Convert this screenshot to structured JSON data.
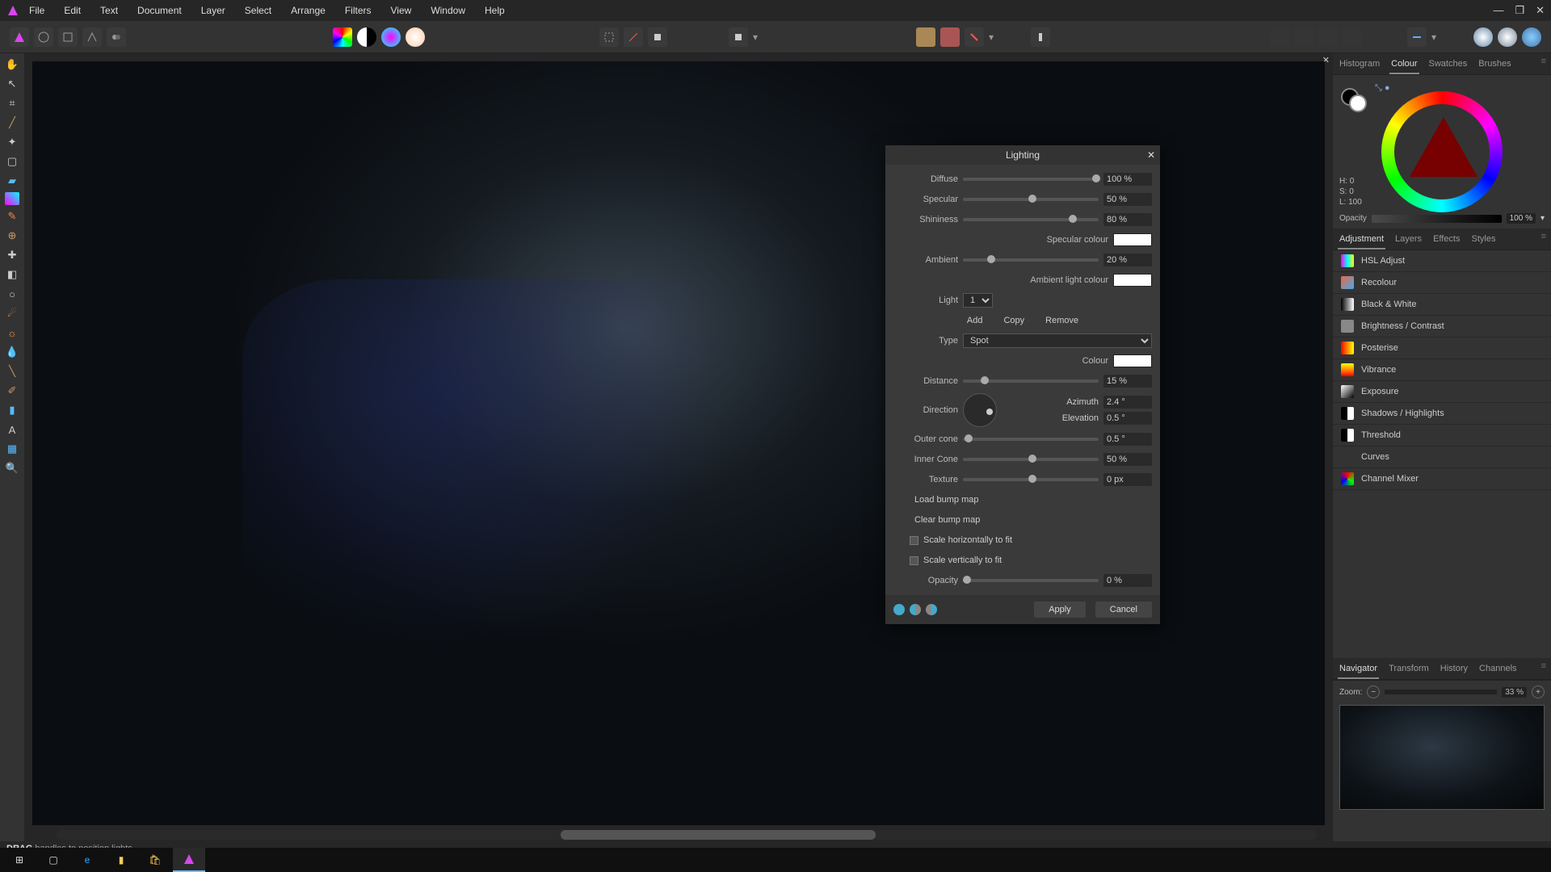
{
  "menu": [
    "File",
    "Edit",
    "Text",
    "Document",
    "Layer",
    "Select",
    "Arrange",
    "Filters",
    "View",
    "Window",
    "Help"
  ],
  "panels": {
    "colour_tabs": [
      "Histogram",
      "Colour",
      "Swatches",
      "Brushes"
    ],
    "colour_active": "Colour",
    "hsl": {
      "h": "H: 0",
      "s": "S: 0",
      "l": "L: 100"
    },
    "opacity_label": "Opacity",
    "opacity_value": "100 %",
    "adj_tabs": [
      "Adjustment",
      "Layers",
      "Effects",
      "Styles"
    ],
    "adj_active": "Adjustment",
    "adjustments": [
      "HSL Adjust",
      "Recolour",
      "Black & White",
      "Brightness / Contrast",
      "Posterise",
      "Vibrance",
      "Exposure",
      "Shadows / Highlights",
      "Threshold",
      "Curves",
      "Channel Mixer"
    ],
    "nav_tabs": [
      "Navigator",
      "Transform",
      "History",
      "Channels"
    ],
    "nav_active": "Navigator",
    "zoom_label": "Zoom:",
    "zoom_value": "33 %"
  },
  "dialog": {
    "title": "Lighting",
    "diffuse_label": "Diffuse",
    "diffuse_value": "100 %",
    "specular_label": "Specular",
    "specular_value": "50 %",
    "shininess_label": "Shininess",
    "shininess_value": "80 %",
    "specular_colour_label": "Specular colour",
    "ambient_label": "Ambient",
    "ambient_value": "20 %",
    "ambient_colour_label": "Ambient light colour",
    "light_label": "Light",
    "light_value": "1",
    "add": "Add",
    "copy": "Copy",
    "remove": "Remove",
    "type_label": "Type",
    "type_value": "Spot",
    "colour_label": "Colour",
    "distance_label": "Distance",
    "distance_value": "15 %",
    "direction_label": "Direction",
    "azimuth_label": "Azimuth",
    "azimuth_value": "2.4 °",
    "elevation_label": "Elevation",
    "elevation_value": "0.5 °",
    "outer_label": "Outer cone",
    "outer_value": "0.5 °",
    "inner_label": "Inner Cone",
    "inner_value": "50 %",
    "texture_label": "Texture",
    "texture_value": "0 px",
    "load_bump": "Load bump map",
    "clear_bump": "Clear bump map",
    "scale_h": "Scale horizontally to fit",
    "scale_v": "Scale vertically to fit",
    "opacity_label": "Opacity",
    "opacity_value": "0 %",
    "apply": "Apply",
    "cancel": "Cancel"
  },
  "status": {
    "strong": "DRAG",
    "rest": "handles to position lights."
  },
  "adj_colors": [
    "linear-gradient(90deg,#f0f,#0ff,#ff0)",
    "linear-gradient(135deg,#e64,#4ae)",
    "linear-gradient(90deg,#000,#fff)",
    "#888",
    "linear-gradient(90deg,#f00,#f80,#ff0)",
    "linear-gradient(180deg,#ff0,#f80,#f00)",
    "linear-gradient(135deg,#fff,#000)",
    "linear-gradient(90deg,#000 50%,#fff 50%)",
    "linear-gradient(90deg,#000 50%,#fff 50%)",
    "#333",
    "conic-gradient(red,lime,blue,red)"
  ]
}
